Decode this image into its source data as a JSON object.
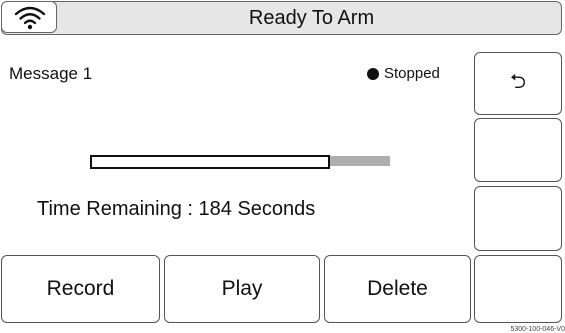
{
  "header": {
    "title": "Ready To Arm",
    "wifi_icon": "wifi-icon"
  },
  "message": {
    "name": "Message 1",
    "status": "Stopped",
    "status_icon": "filled-circle-icon"
  },
  "progress": {
    "fraction": 0.8
  },
  "time_remaining": "Time Remaining  :  184 Seconds",
  "side_buttons": [
    {
      "icon": "back-arrow-icon",
      "glyph": "⮌"
    },
    {
      "label": ""
    },
    {
      "label": ""
    },
    {
      "label": ""
    }
  ],
  "buttons": {
    "record": "Record",
    "play": "Play",
    "delete": "Delete"
  },
  "part_number": "5300-100-046-V0"
}
